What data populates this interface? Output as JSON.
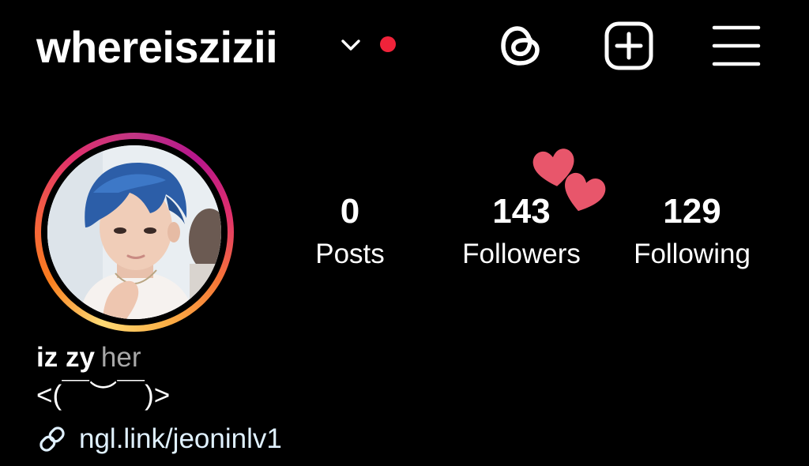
{
  "header": {
    "username": "whereiszizii",
    "switch_icon": "chevron-down-icon",
    "notification_dot_color": "#f0233a",
    "actions": [
      {
        "name": "threads",
        "icon": "threads-icon"
      },
      {
        "name": "create",
        "icon": "plus-square-icon"
      },
      {
        "name": "menu",
        "icon": "hamburger-menu-icon"
      }
    ]
  },
  "profile": {
    "avatar_ring_colors": [
      "#feda75",
      "#fa7e1e",
      "#e1306c",
      "#b6168c"
    ],
    "stats": {
      "posts": {
        "value": "0",
        "label": "Posts"
      },
      "followers": {
        "value": "143",
        "label": "Followers"
      },
      "following": {
        "value": "129",
        "label": "Following"
      }
    },
    "decoration": {
      "icon": "hearts-sticker-icon",
      "color": "#e8566b"
    },
    "display_name": "iz zy",
    "pronouns": "her",
    "bio": "<(￣︶￣)>",
    "link": {
      "icon": "link-icon",
      "text": "ngl.link/jeoninlv1"
    }
  },
  "colors": {
    "background": "#000000",
    "text": "#ffffff",
    "secondary_text": "#a8a8a8",
    "link": "#e0f1ff"
  }
}
